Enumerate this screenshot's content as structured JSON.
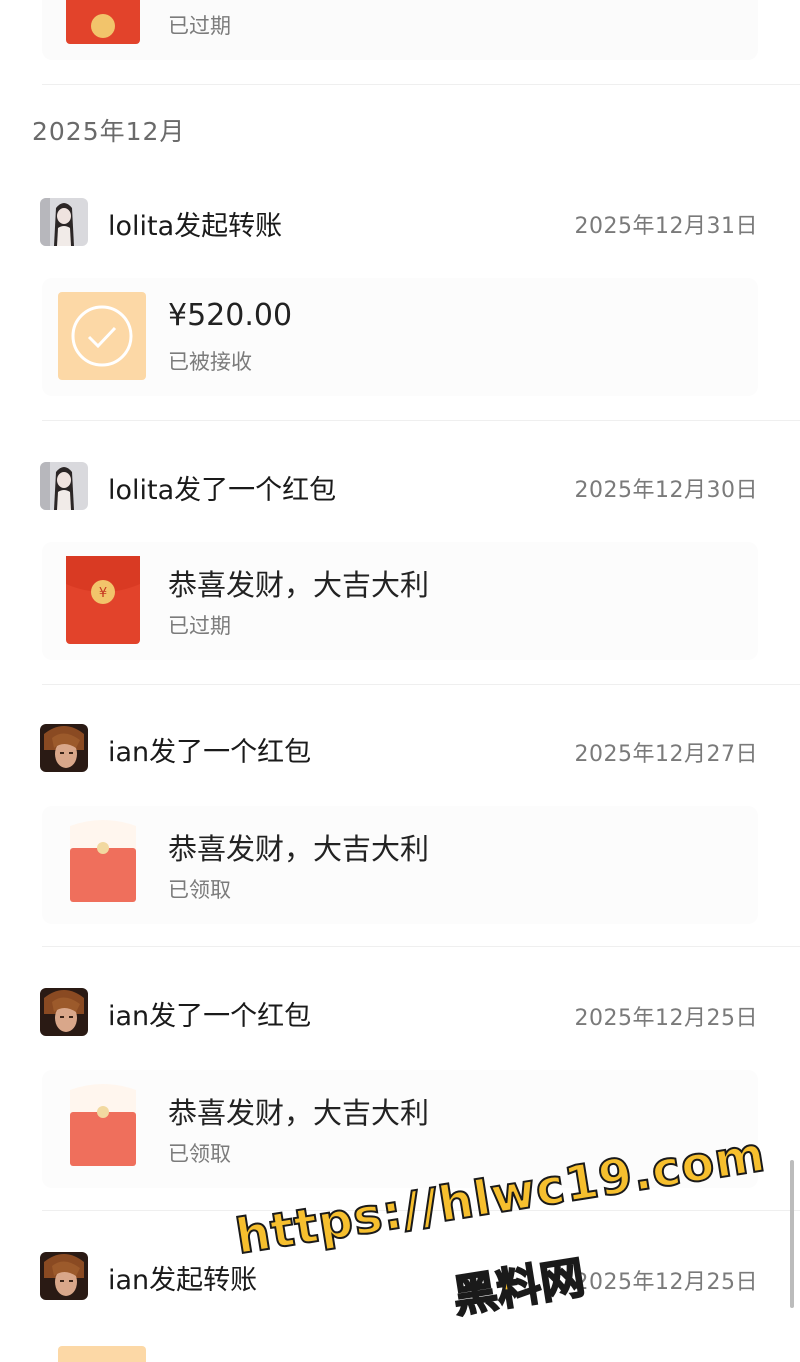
{
  "top_card": {
    "status": "已过期"
  },
  "month": "2025年12月",
  "records": [
    {
      "sender_title": "lolita发起转账",
      "date": "2025年12月31日",
      "main": "¥520.00",
      "status": "已被接收",
      "icon": "transfer-received-icon"
    },
    {
      "sender_title": "lolita发了一个红包",
      "date": "2025年12月30日",
      "main": "恭喜发财，大吉大利",
      "status": "已过期",
      "icon": "red-packet-expired-icon"
    },
    {
      "sender_title": "ian发了一个红包",
      "date": "2025年12月27日",
      "main": "恭喜发财，大吉大利",
      "status": "已领取",
      "icon": "red-packet-opened-icon"
    },
    {
      "sender_title": "ian发了一个红包",
      "date": "2025年12月25日",
      "main": "恭喜发财，大吉大利",
      "status": "已领取",
      "icon": "red-packet-opened-icon"
    },
    {
      "sender_title": "ian发起转账",
      "date": "2025年12月25日",
      "main": "",
      "status": "",
      "icon": "transfer-icon"
    }
  ],
  "watermark": {
    "url": "https://hlwc19.com",
    "site": "黑料网"
  },
  "colors": {
    "red_packet": "#e2432b",
    "red_packet_opened": "#ef6f5c",
    "transfer_tile": "#fcd8a6",
    "watermark": "#f6bf2e"
  }
}
